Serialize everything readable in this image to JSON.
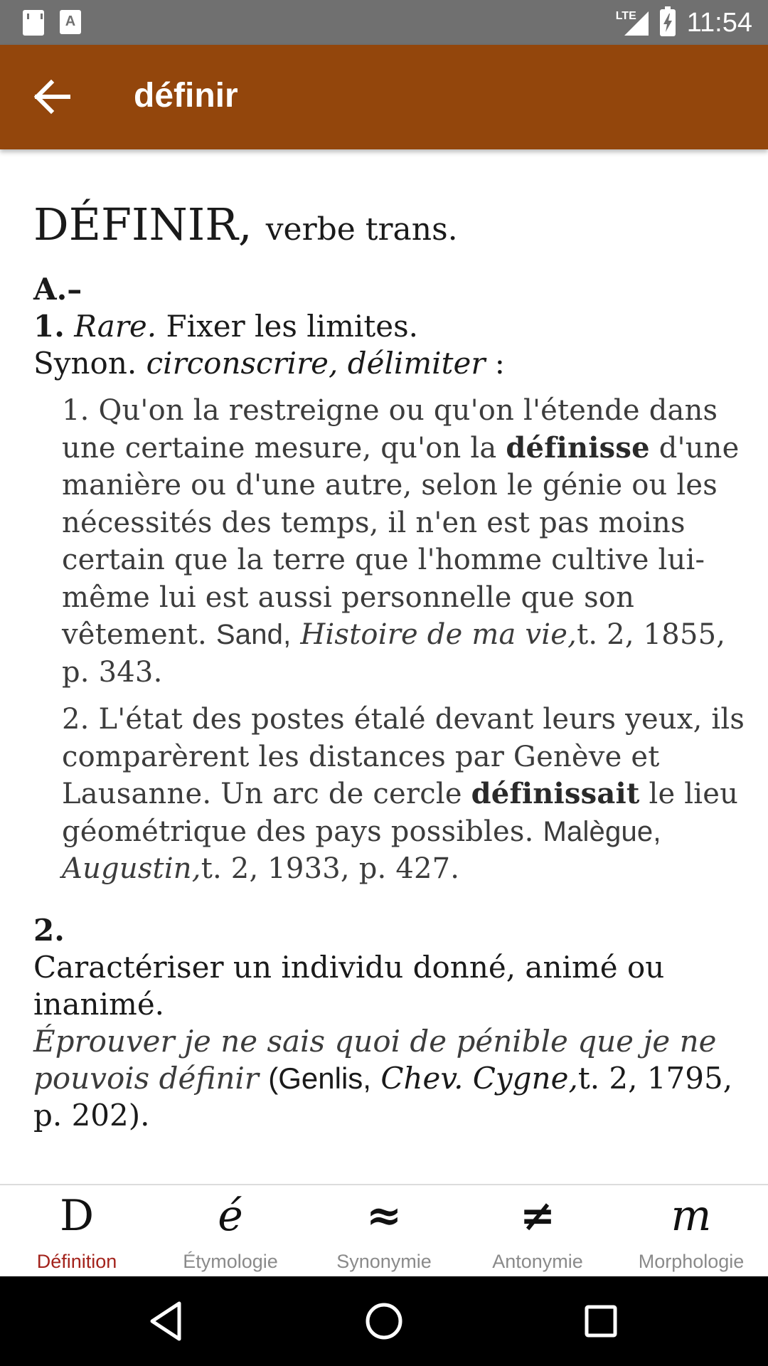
{
  "status_bar": {
    "time": "11:54",
    "network": "LTE",
    "icons": [
      "sd-card-icon",
      "font-a-icon",
      "signal-icon",
      "battery-charging-icon"
    ]
  },
  "app_bar": {
    "title": "définir",
    "back_icon": "arrow-left-icon"
  },
  "entry": {
    "headword": "DÉFINIR,",
    "pos": "verbe trans.",
    "section_a": "A.–",
    "sense1": {
      "num": "1.",
      "label": "Rare.",
      "definition": "Fixer les limites.",
      "synon_prefix": "Synon.",
      "synonyms": "circonscrire, délimiter",
      "synon_suffix": ":",
      "quotes": [
        {
          "pre": "1. Qu'on la restreigne ou qu'on l'étende dans une certaine mesure, qu'on la",
          "bold": "définisse",
          "post": "d'une manière ou d'une autre, selon le génie ou les nécessités des temps, il n'en est pas moins certain que la terre que l'homme cultive lui-même lui est aussi personnelle que son vêtement.",
          "author": "Sand,",
          "work": "Histoire de ma vie,",
          "ref": "t. 2, 1855, p. 343."
        },
        {
          "pre": "2. L'état des postes étalé devant leurs yeux, ils comparèrent les distances par Genève et Lausanne. Un arc de cercle",
          "bold": "définissait",
          "post": "le lieu géométrique des pays possibles.",
          "author": "Malègue,",
          "work": "Augustin,",
          "ref": "t. 2, 1933, p. 427."
        }
      ]
    },
    "sense2": {
      "num": "2.",
      "definition": "Caractériser un individu donné, animé ou inanimé.",
      "example": "Éprouver je ne sais quoi de pénible que je ne pouvois définir",
      "src_open": "(Genlis,",
      "src_work": "Chev. Cygne,",
      "src_ref": "t. 2, 1795, p. 202)."
    }
  },
  "tabs": [
    {
      "icon": "D",
      "label": "Définition",
      "active": true
    },
    {
      "icon": "é",
      "label": "Étymologie",
      "active": false
    },
    {
      "icon": "≈",
      "label": "Synonymie",
      "active": false
    },
    {
      "icon": "≠",
      "label": "Antonymie",
      "active": false
    },
    {
      "icon": "m",
      "label": "Morphologie",
      "active": false
    }
  ],
  "colors": {
    "app_bar": "#93460c",
    "status_bar": "#707070",
    "active_tab": "#a3231c",
    "inactive_tab": "#8a8a8a"
  }
}
